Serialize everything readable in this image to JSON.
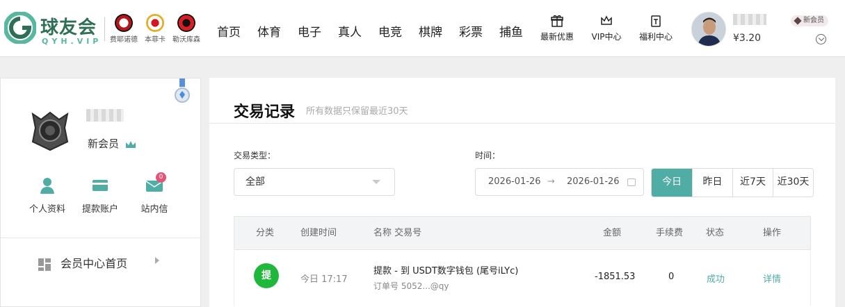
{
  "brand": {
    "name": "球友会",
    "sub": "QYH.VIP"
  },
  "teams": [
    {
      "name": "费耶诺德",
      "color": "#b3171d"
    },
    {
      "name": "本菲卡",
      "color": "#d4161e"
    },
    {
      "name": "勒沃库森",
      "color": "#d81e25"
    }
  ],
  "nav": [
    "首页",
    "体育",
    "电子",
    "真人",
    "电竞",
    "棋牌",
    "彩票",
    "捕鱼"
  ],
  "nav_icons": [
    {
      "label": "最新优惠",
      "icon": "gift-icon"
    },
    {
      "label": "VIP中心",
      "icon": "crown-icon"
    },
    {
      "label": "福利中心",
      "icon": "welfare-icon"
    }
  ],
  "user": {
    "balance": "¥3.20",
    "level": "新会员"
  },
  "sidebar": {
    "level": "新会员",
    "quick": [
      {
        "label": "个人资料",
        "icon": "user-icon"
      },
      {
        "label": "提款账户",
        "icon": "card-icon"
      },
      {
        "label": "站内信",
        "icon": "mail-icon",
        "badge": "0"
      }
    ],
    "menu": "会员中心首页"
  },
  "main": {
    "title": "交易记录",
    "subtitle": "所有数据只保留最近30天",
    "filter_type_label": "交易类型：",
    "filter_type_value": "全部",
    "time_label": "时间：",
    "date_from": "2026-01-26",
    "date_arrow": "→",
    "date_to": "2026-01-26",
    "ranges": [
      "今日",
      "昨日",
      "近7天",
      "近30天"
    ],
    "active_range": 0,
    "columns": [
      "分类",
      "创建时间",
      "名称 交易号",
      "金额",
      "手续费",
      "状态",
      "操作"
    ],
    "rows": [
      {
        "type": "提",
        "time": "今日 17:17",
        "name": "提款 - 到 USDT数字钱包 (尾号iLYc)",
        "order": "订单号 5052...@qy",
        "amount": "-1851.53",
        "fee": "0",
        "status": "成功",
        "action": "详情"
      }
    ]
  },
  "colors": {
    "accent": "#4fada6",
    "success_badge": "#1fb83a",
    "notify": "#e0577a"
  }
}
